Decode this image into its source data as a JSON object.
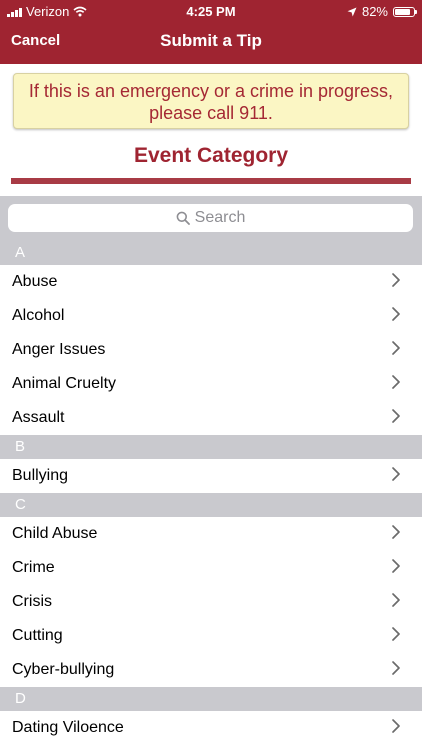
{
  "status_bar": {
    "carrier": "Verizon",
    "time": "4:25 PM",
    "battery": "82%",
    "battery_level": 0.82
  },
  "nav": {
    "cancel_label": "Cancel",
    "title": "Submit a Tip"
  },
  "banner": {
    "line1": "If this is an emergency or a crime in progress,",
    "line2": "please call 911."
  },
  "section_title": "Event Category",
  "search": {
    "placeholder": "Search"
  },
  "sections": [
    {
      "letter": "A",
      "items": [
        "Abuse",
        "Alcohol",
        "Anger Issues",
        "Animal Cruelty",
        "Assault"
      ]
    },
    {
      "letter": "B",
      "items": [
        "Bullying"
      ]
    },
    {
      "letter": "C",
      "items": [
        "Child Abuse",
        "Crime",
        "Crisis",
        "Cutting",
        "Cyber-bullying"
      ]
    },
    {
      "letter": "D",
      "items": [
        "Dating Viloence"
      ]
    }
  ],
  "colors": {
    "brand": "#9f2431",
    "banner_bg": "#fbf6c4",
    "section_header_bg": "#c9c9ce"
  }
}
